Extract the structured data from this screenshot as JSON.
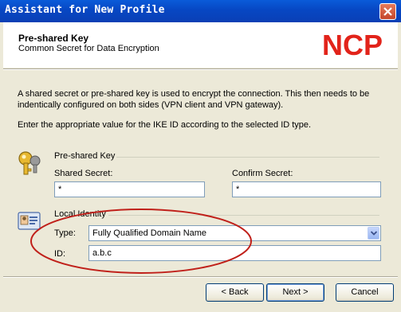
{
  "window": {
    "title": "Assistant for New Profile"
  },
  "header": {
    "title": "Pre-shared Key",
    "subtitle": "Common Secret for Data Encryption",
    "logo_text": "NCP"
  },
  "description": {
    "paragraph1": "A shared secret or pre-shared key is used to encrypt the connection. This then needs to be indentically configured on both sides (VPN client and VPN gateway).",
    "paragraph2": "Enter the appropriate value for the IKE ID according to the selected ID type."
  },
  "preshared": {
    "group_label": "Pre-shared Key",
    "shared_secret_label": "Shared Secret:",
    "shared_secret_value": "*",
    "confirm_secret_label": "Confirm Secret:",
    "confirm_secret_value": "*"
  },
  "identity": {
    "group_label": "Local Identity",
    "type_label": "Type:",
    "type_value": "Fully Qualified Domain Name",
    "id_label": "ID:",
    "id_value": "a.b.c"
  },
  "buttons": {
    "back": "< Back",
    "next": "Next >",
    "cancel": "Cancel"
  },
  "colors": {
    "titlebar": "#0a50d0",
    "logo_red": "#e2231a",
    "highlight_ellipse": "#c0201a"
  }
}
